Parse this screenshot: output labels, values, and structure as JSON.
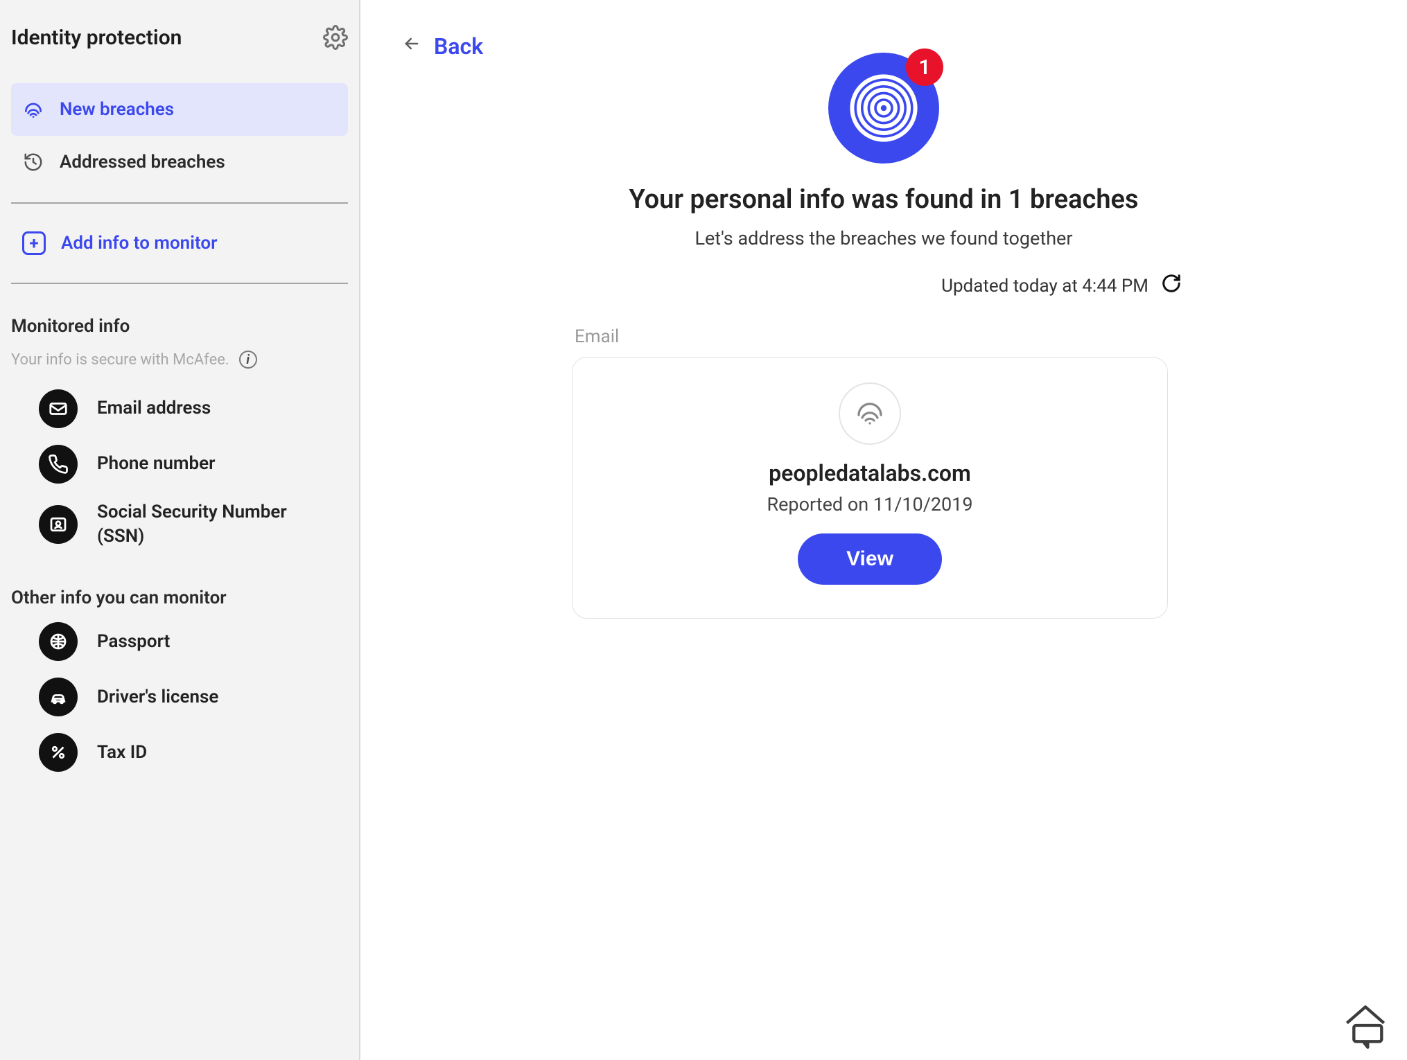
{
  "sidebar": {
    "title": "Identity protection",
    "nav": {
      "new_breaches": "New breaches",
      "addressed_breaches": "Addressed breaches"
    },
    "add_info": "Add info to monitor",
    "monitored_title": "Monitored info",
    "secure_note": "Your info is secure with McAfee.",
    "monitored": [
      {
        "label": "Email address"
      },
      {
        "label": "Phone number"
      },
      {
        "label": "Social Security Number (SSN)"
      }
    ],
    "other_title": "Other info you can monitor",
    "other": [
      {
        "label": "Passport"
      },
      {
        "label": "Driver's license"
      },
      {
        "label": "Tax ID"
      }
    ]
  },
  "main": {
    "back": "Back",
    "badge_count": "1",
    "heading": "Your personal info was found in 1 breaches",
    "subheading": "Let's address the breaches we found together",
    "updated": "Updated today at 4:44 PM",
    "section_label": "Email",
    "breach": {
      "origin": "peopledatalabs.com",
      "reported": "Reported on 11/10/2019",
      "view": "View"
    }
  }
}
